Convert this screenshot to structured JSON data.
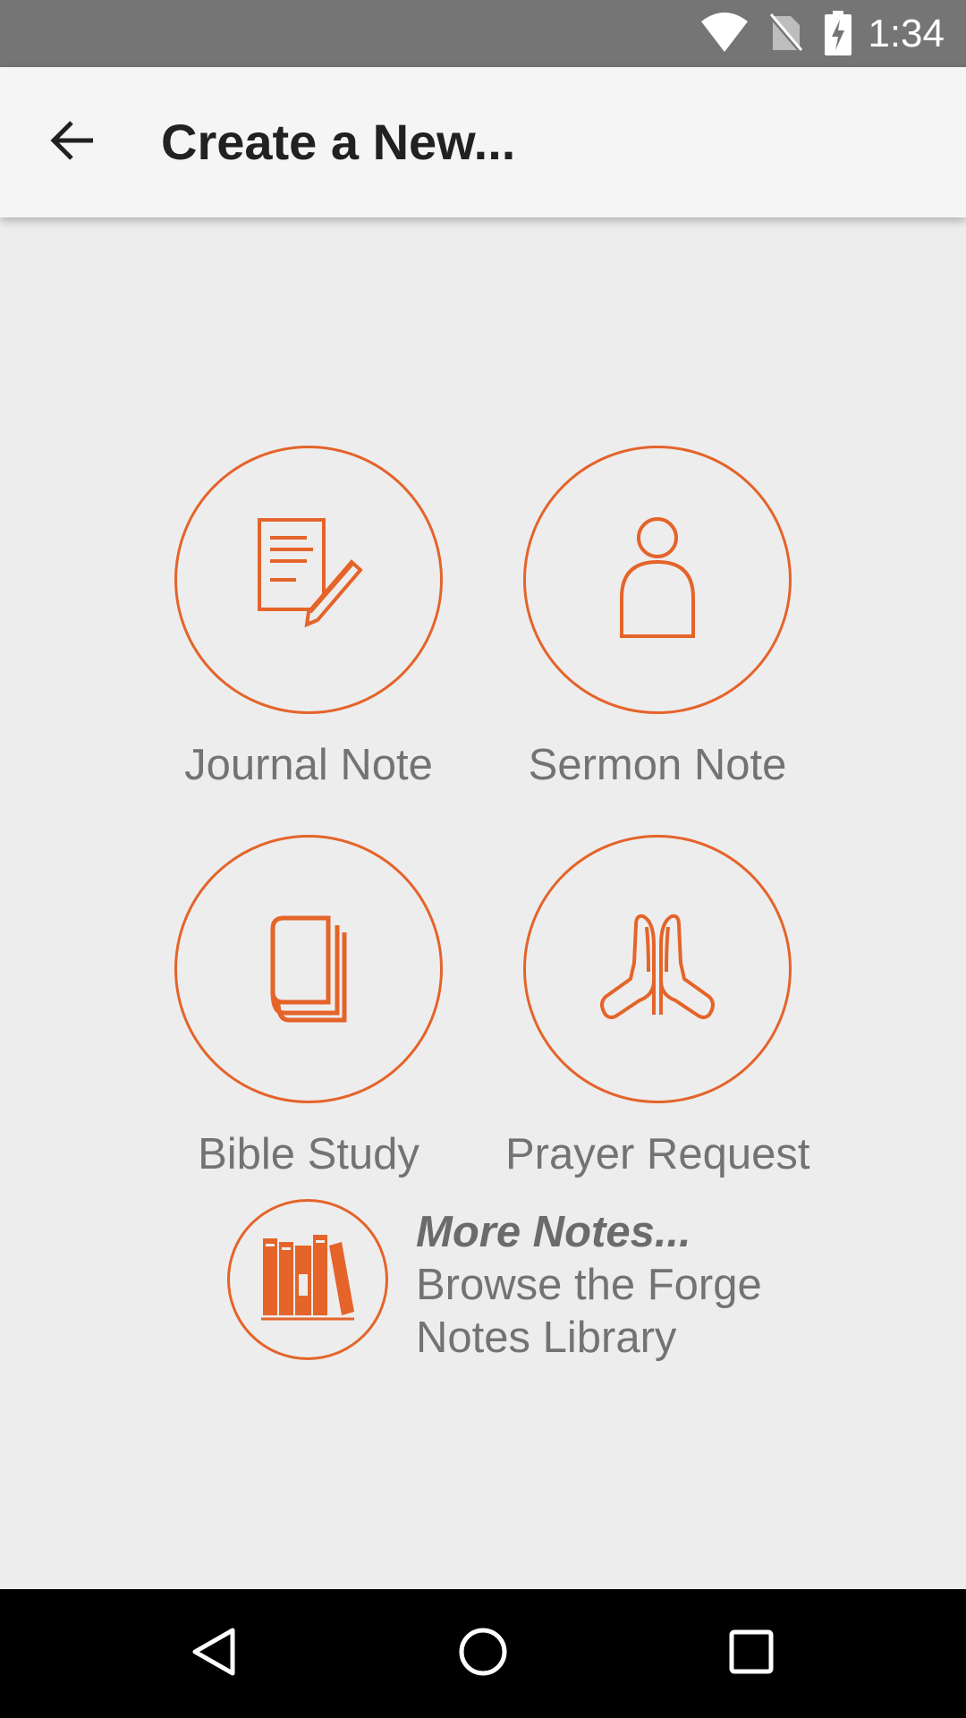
{
  "status_bar": {
    "time": "1:34",
    "icons": [
      "wifi-icon",
      "no-sim-icon",
      "battery-charging-icon"
    ]
  },
  "app_bar": {
    "back_icon": "arrow-back-icon",
    "title": "Create a New..."
  },
  "options": [
    {
      "label": "Journal Note",
      "icon": "journal-note-icon"
    },
    {
      "label": "Sermon Note",
      "icon": "person-icon"
    },
    {
      "label": "Bible Study",
      "icon": "book-icon"
    },
    {
      "label": "Prayer Request",
      "icon": "praying-hands-icon"
    }
  ],
  "more_notes": {
    "icon": "library-books-icon",
    "title": "More Notes...",
    "line1": "Browse the Forge",
    "line2": "Notes Library"
  },
  "nav_bar": {
    "buttons": [
      "back-triangle-icon",
      "home-circle-icon",
      "recents-square-icon"
    ]
  },
  "colors": {
    "accent": "#e4642a",
    "status_bar": "#757575",
    "app_bar": "#f5f5f5",
    "background": "#eeeded",
    "label_text": "#737373"
  }
}
